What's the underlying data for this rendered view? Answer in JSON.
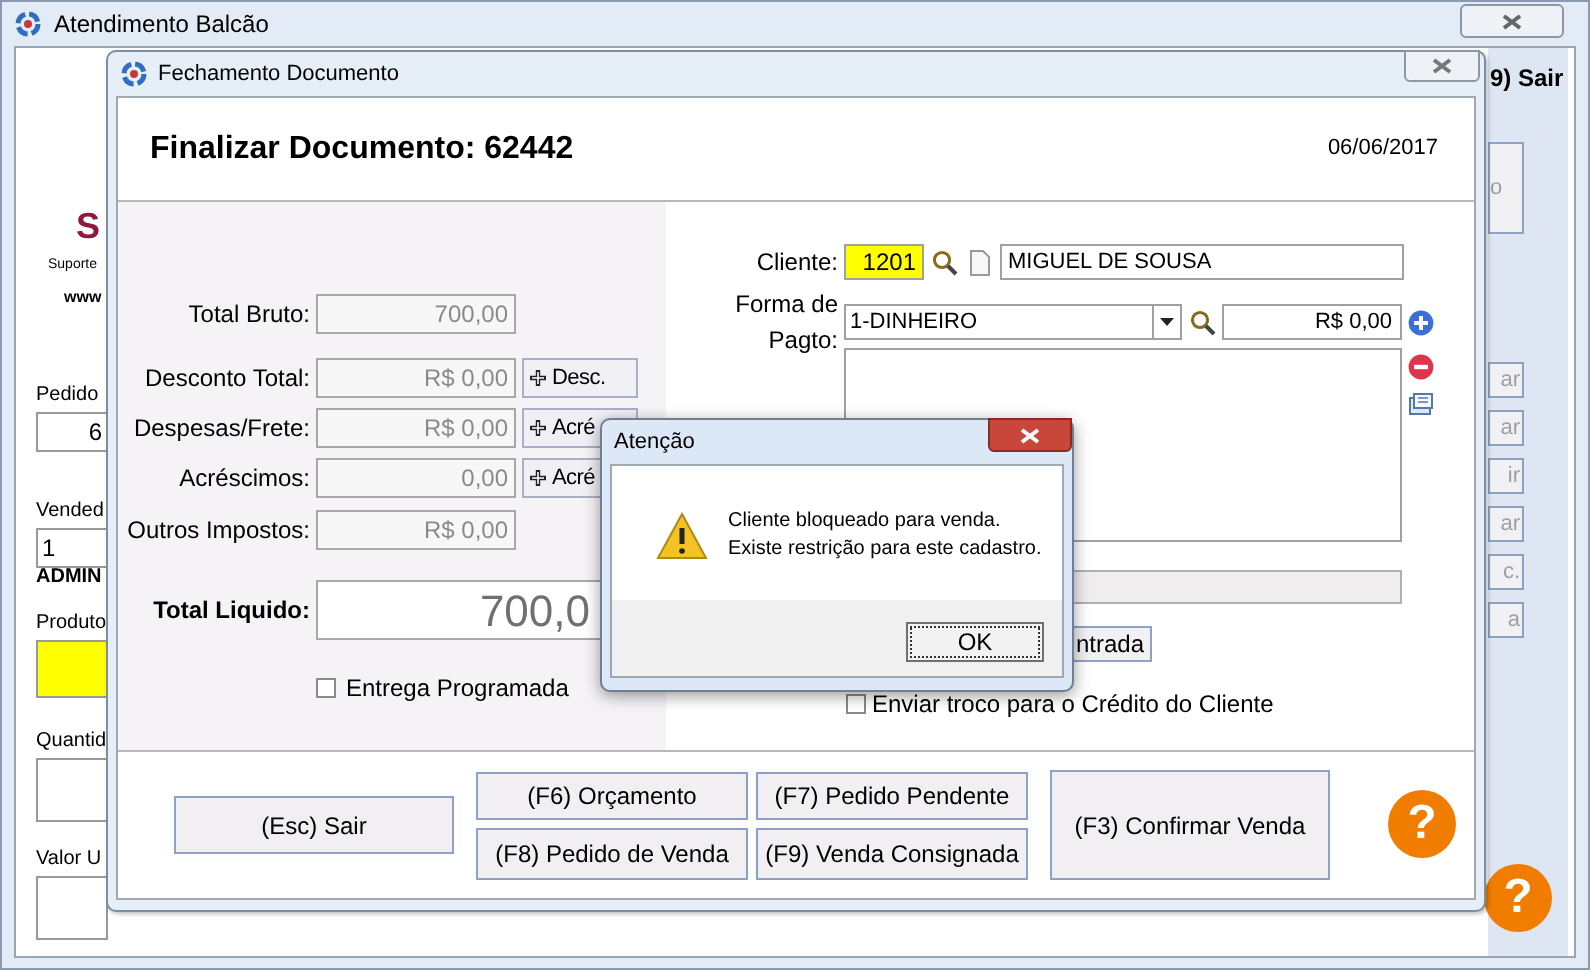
{
  "main_window": {
    "title": "Atendimento Balcão",
    "logo_letter": "S",
    "support_text": "Suporte",
    "web_text": "www",
    "fields": [
      {
        "label": "Pedido",
        "value": "6",
        "kind": "plain"
      },
      {
        "label": "Vended",
        "value": "1",
        "kind": "plain"
      },
      {
        "label": "ADMIN",
        "kind": "caption"
      },
      {
        "label": "Produto",
        "kind": "yellow"
      },
      {
        "label": "Quantid",
        "kind": "plain"
      },
      {
        "label": "Valor U",
        "kind": "plain"
      }
    ],
    "exit_button": "9) Sair",
    "side_box": "o",
    "side_buttons": [
      "ar",
      "ar",
      "ir",
      "ar",
      "c.",
      "a"
    ],
    "help_button": "?"
  },
  "closing_dialog": {
    "title": "Fechamento Documento",
    "heading": "Finalizar Documento: 62442",
    "date": "06/06/2017",
    "totals": [
      {
        "label": "Total Bruto:",
        "value": "700,00"
      },
      {
        "label": "Desconto Total:",
        "value": "R$ 0,00",
        "button": "Desc."
      },
      {
        "label": "Despesas/Frete:",
        "value": "R$ 0,00",
        "button": "Acré"
      },
      {
        "label": "Acréscimos:",
        "value": "0,00",
        "button": "Acré"
      },
      {
        "label": "Outros Impostos:",
        "value": "R$ 0,00"
      }
    ],
    "net_total": {
      "label": "Total Liquido:",
      "value": "700,0"
    },
    "scheduled_delivery": {
      "label": "Entrega Programada",
      "checked": false
    },
    "client": {
      "label": "Cliente:",
      "code": "1201",
      "name": "MIGUEL DE SOUSA"
    },
    "payment": {
      "label": "Forma de Pagto:",
      "method": "1-DINHEIRO",
      "amount": "R$ 0,00"
    },
    "entry_button": "ntrada",
    "change_to_credit": {
      "label": "Enviar troco para o Crédito do Cliente",
      "checked": false
    },
    "buttons": {
      "exit": "(Esc) Sair",
      "quote": "(F6) Orçamento",
      "pending": "(F7) Pedido Pendente",
      "order": "(F8) Pedido de Venda",
      "consigned": "(F9) Venda Consignada",
      "confirm": "(F3) Confirmar Venda"
    },
    "help_button": "?"
  },
  "alert": {
    "title": "Atenção",
    "message_lines": [
      "Cliente bloqueado para venda.",
      "Existe restrição para este cadastro."
    ],
    "ok": "OK"
  }
}
